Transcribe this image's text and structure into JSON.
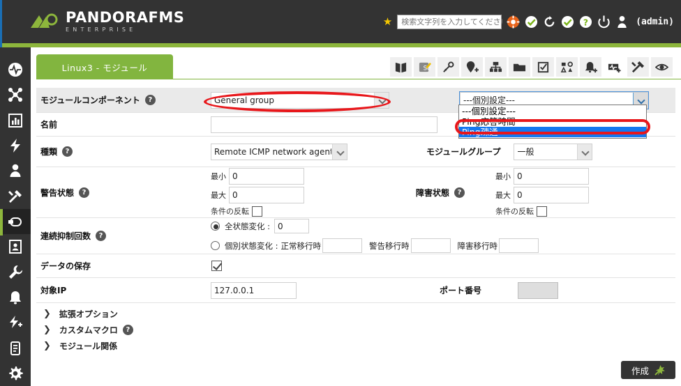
{
  "header": {
    "brand_title": "PANDORAFMS",
    "brand_subtitle": "ENTERPRISE",
    "search_placeholder": "検索文字列を入力してください",
    "search_value": "",
    "user_label": "(admin)",
    "icons": [
      "star-icon",
      "search-icon",
      "lifebuoy-icon",
      "check-circle-icon",
      "refresh-icon",
      "check-circle-icon",
      "question-circle-icon",
      "power-icon",
      "user-icon"
    ],
    "accent_green": "#8db63c",
    "bg_dark": "#333333"
  },
  "sidebar": {
    "items": [
      {
        "name": "monitoring-icon",
        "active": false
      },
      {
        "name": "topology-icon",
        "active": false
      },
      {
        "name": "reports-icon",
        "active": false
      },
      {
        "name": "events-icon",
        "active": false
      },
      {
        "name": "user-icon",
        "active": false
      },
      {
        "name": "tools-icon",
        "active": false
      },
      {
        "name": "resources-icon",
        "active": true
      },
      {
        "name": "profile-card-icon",
        "active": false
      },
      {
        "name": "wrench-icon",
        "active": false
      },
      {
        "name": "bell-icon",
        "active": false
      },
      {
        "name": "alert-plus-icon",
        "active": false
      },
      {
        "name": "list-icon",
        "active": false
      },
      {
        "name": "gear-icon",
        "active": false
      }
    ]
  },
  "tabs": {
    "active_label": "Linux3 - モジュール",
    "icons": [
      {
        "name": "book-icon",
        "selected": false
      },
      {
        "name": "edit-agent-icon",
        "selected": false
      },
      {
        "name": "key-icon",
        "selected": false
      },
      {
        "name": "location-plus-icon",
        "selected": false
      },
      {
        "name": "network-icon",
        "selected": false
      },
      {
        "name": "folder-icon",
        "selected": false
      },
      {
        "name": "checklist-icon",
        "selected": false
      },
      {
        "name": "collection-icon",
        "selected": false
      },
      {
        "name": "bell-plus-icon",
        "selected": false
      },
      {
        "name": "module-plus-icon",
        "selected": true
      },
      {
        "name": "tools-icon",
        "selected": false
      },
      {
        "name": "eye-icon",
        "selected": false
      }
    ]
  },
  "form": {
    "module_component": {
      "label": "モジュールコンポーネント",
      "help": "?",
      "group_value": "General group",
      "component_value": "---個別設定---",
      "component_options": [
        "---個別設定---",
        "Ping応答時間",
        "Ping疎通"
      ],
      "component_highlighted": "Ping疎通",
      "highlight_color": "#1478f0",
      "annotation_color": "#e8171b"
    },
    "name": {
      "label": "名前",
      "value": ""
    },
    "type": {
      "label": "種類",
      "help": "?",
      "value": "Remote ICMP network agent (Enterprise)"
    },
    "module_group": {
      "label": "モジュールグループ",
      "value": "一般"
    },
    "warning_state": {
      "label": "警告状態",
      "help": "?",
      "min_label": "最小",
      "min_value": "0",
      "max_label": "最大",
      "max_value": "0",
      "invert_label": "条件の反転",
      "invert_checked": false
    },
    "critical_state": {
      "label": "障害状態",
      "help": "?",
      "min_label": "最小",
      "min_value": "0",
      "max_label": "最大",
      "max_value": "0",
      "invert_label": "条件の反転",
      "invert_checked": false
    },
    "ff_threshold": {
      "label": "連続抑制回数",
      "help": "?",
      "all_label": "全状態変化 :",
      "all_value": "0",
      "all_selected": true,
      "each_label": "個別状態変化 :",
      "each_selected": false,
      "to_normal_label": "正常移行時",
      "to_normal_value": "",
      "to_warning_label": "警告移行時",
      "to_warning_value": "",
      "to_critical_label": "障害移行時",
      "to_critical_value": ""
    },
    "store_data": {
      "label": "データの保存",
      "checked": true
    },
    "target_ip": {
      "label": "対象IP",
      "value": "127.0.0.1"
    },
    "port": {
      "label": "ポート番号",
      "value": "",
      "disabled": true
    },
    "expanders": [
      {
        "label": "拡張オプション",
        "help": null
      },
      {
        "label": "カスタムマクロ",
        "help": "?"
      },
      {
        "label": "モジュール関係",
        "help": null
      }
    ]
  },
  "footer": {
    "create_label": "作成",
    "create_icon": "wand-icon"
  }
}
